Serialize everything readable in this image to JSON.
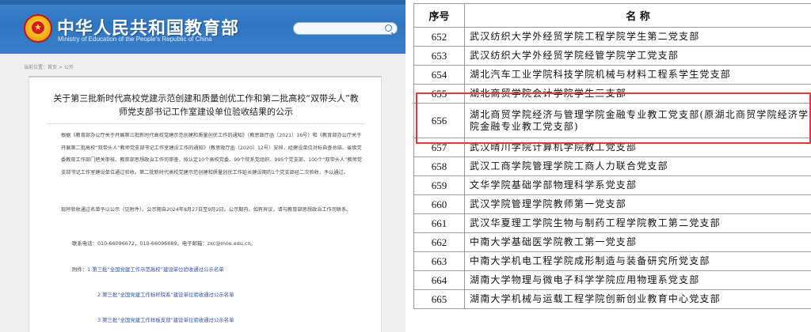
{
  "site": {
    "logo_cn": "中华人民共和国教育部",
    "logo_en": "Ministry of Education of the People's Republic of China",
    "breadcrumb": "当前位置：首页 > 公开"
  },
  "notice": {
    "title": "关于第三批新时代高校党建示范创建和质量创优工作和第二批高校“双带头人”教师党支部书记工作室建设单位验收结果的公示",
    "paragraph1": "根据《教育部办公厅关于开展第三批新时代高校党建示范创建和质量创优工作的通知》（教思政厅函〔2021〕16号）和《教育部办公厅关于开展第二批高校“双带头人”教师党支部书记工作室建设工作的通知》（教思政厅函〔2020〕12号）安排，经建设单位对标自查总结、省级党委教育工作部门把关审核、教育部思想政治工作司审查，拟认定10个高校党委、99个院系党组织、995个党支部、100个“双带头人”教师党支部书记工作室建设单位通过验收。第二批新时代高校党建示范创建和质量创优工作延长建设期的1个党支部经二次验收，予以通过。",
    "paragraph2": "现将验收通过名单予以公示（见附件）。公示期自2024年8月27日至9月2日。公示期内，如有异议，请与教育部思想政治工作司联系。",
    "contact": "联系电话：010-66096672，010-66096689，电子邮箱：zxc@moe.edu.cn。",
    "attachments_label": "附件：",
    "attachments": [
      "1.第三批“全国党建工作示范高校”建设单位验收通过公示名单",
      "2.第三批“全国党建工作标杆院系”建设单位验收通过公示名单",
      "3.第三批“全国党建工作样板支部”建设单位验收通过公示名单"
    ]
  },
  "table": {
    "headers": [
      "序号",
      "名  称"
    ],
    "rows": [
      {
        "num": "652",
        "name": "武汉纺织大学外经贸学院工程学院学生第二党支部"
      },
      {
        "num": "653",
        "name": "武汉纺织大学外经贸学院经管学院学工党支部"
      },
      {
        "num": "654",
        "name": "湖北汽车工业学院科技学院机械与材料工程系学生党支部"
      },
      {
        "num": "655",
        "name": "湖北商贸学院会计学院学生三支部"
      },
      {
        "num": "656",
        "name": "湖北商贸学院经济与管理学院金融专业教工党支部(原湖北商贸学院经济学院金融专业教工党支部)"
      },
      {
        "num": "657",
        "name": "武汉晴川学院计算机学院教工党支部"
      },
      {
        "num": "658",
        "name": "武汉工商学院管理学院工商人力联合党支部"
      },
      {
        "num": "659",
        "name": "文华学院基础学部物理科学系党支部"
      },
      {
        "num": "660",
        "name": "武汉学院管理学院教师第一党支部"
      },
      {
        "num": "661",
        "name": "武汉华夏理工学院生物与制药工程学院教工第二党支部"
      },
      {
        "num": "662",
        "name": "中南大学基础医学院教工第一党支部"
      },
      {
        "num": "663",
        "name": "中南大学机电工程学院成形制造与装备研究所党支部"
      },
      {
        "num": "664",
        "name": "湖南大学物理与微电子科学学院应用物理系党支部"
      },
      {
        "num": "665",
        "name": "湖南大学机械与运载工程学院创新创业教育中心党支部"
      }
    ],
    "highlight_color": "#e0383c"
  }
}
